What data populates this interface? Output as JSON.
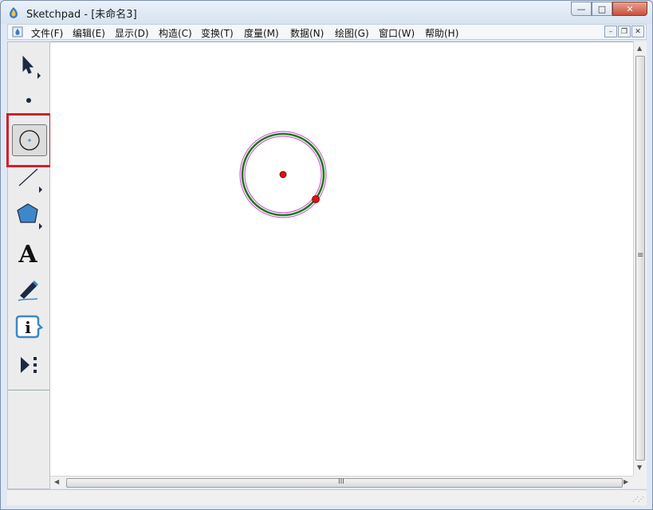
{
  "window": {
    "title": "Sketchpad  - [未命名3]",
    "caption_buttons": {
      "minimize": "—",
      "maximize": "□",
      "close": "✕"
    }
  },
  "menubar": {
    "items": [
      {
        "label": "文件(F)"
      },
      {
        "label": "编辑(E)"
      },
      {
        "label": "显示(D)"
      },
      {
        "label": "构造(C)"
      },
      {
        "label": "变换(T)"
      },
      {
        "label": "度量(M)"
      },
      {
        "label": "数据(N)"
      },
      {
        "label": "绘图(G)"
      },
      {
        "label": "窗口(W)"
      },
      {
        "label": "帮助(H)"
      }
    ],
    "mdi_buttons": {
      "minimize": "–",
      "restore": "❐",
      "close": "✕"
    }
  },
  "toolbox": {
    "tools": [
      {
        "name": "selection-arrow-tool",
        "icon": "arrow-icon"
      },
      {
        "name": "point-tool",
        "icon": "point-icon"
      },
      {
        "name": "compass-tool",
        "icon": "circle-icon",
        "selected": true
      },
      {
        "name": "straightedge-tool",
        "icon": "segment-icon"
      },
      {
        "name": "polygon-tool",
        "icon": "pentagon-icon"
      },
      {
        "name": "text-tool",
        "icon": "text-icon",
        "glyph": "A"
      },
      {
        "name": "marker-tool",
        "icon": "marker-pen-icon"
      },
      {
        "name": "information-tool",
        "icon": "info-icon",
        "glyph": "i"
      },
      {
        "name": "custom-tool",
        "icon": "play-more-icon"
      }
    ],
    "selection_color": "#d0202a"
  },
  "canvas": {
    "circle_stroke_color": "#1e7a1e",
    "circle_highlight_color": "#cc44cc",
    "point_color": "#e01010"
  },
  "scrollbars": {
    "vertical_grip": "≡",
    "horizontal_grip": "III",
    "up_arrow": "▲",
    "down_arrow": "▼",
    "left_arrow": "◀",
    "right_arrow": "▶"
  }
}
